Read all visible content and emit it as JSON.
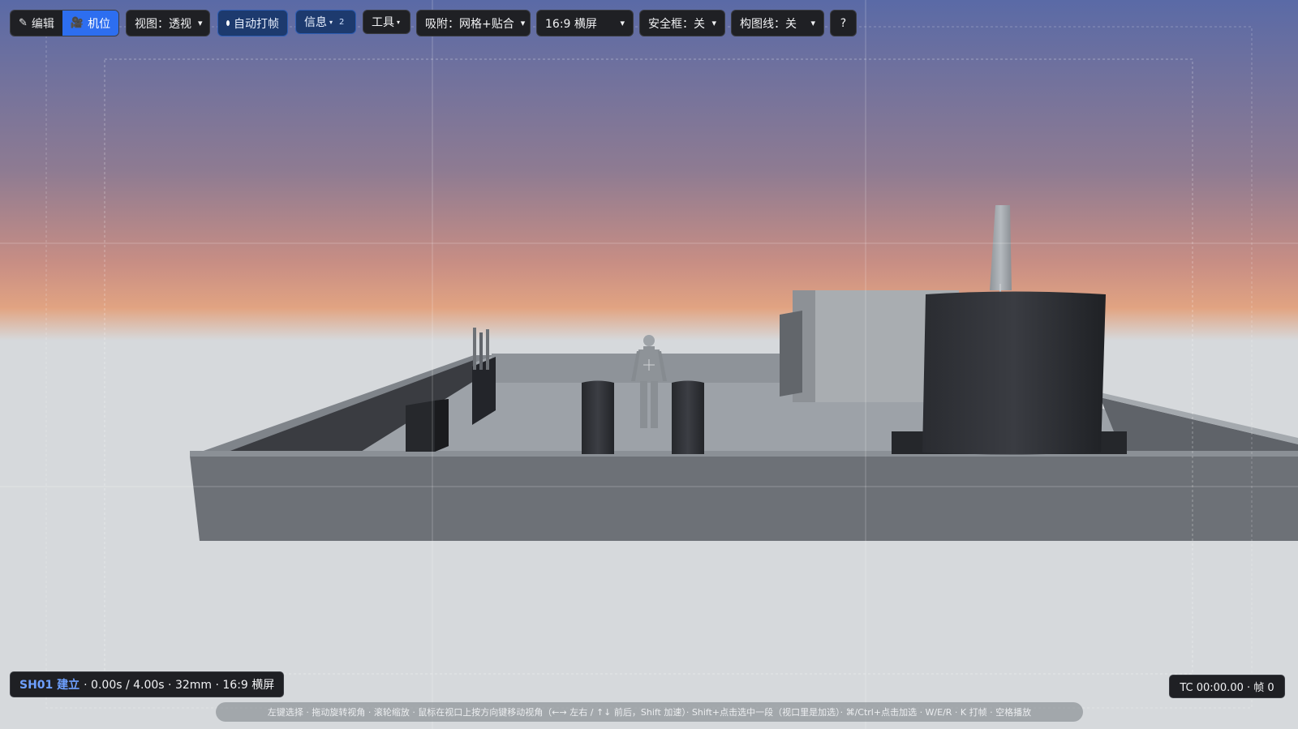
{
  "toolbar": {
    "edit_label": "编辑",
    "camera_label": "机位",
    "view_label": "视图：透视",
    "autokey_label": "自动打帧",
    "info_label": "信息",
    "info_count": "2",
    "tools_label": "工具",
    "snap_label": "吸附：网格+贴合",
    "aspect_label": "16:9 横屏",
    "safe_frame_label": "安全框：关",
    "composition_label": "构图线：关",
    "help_label": "?"
  },
  "shot": {
    "id": "SH01 建立",
    "details": "· 0.00s / 4.00s · 32mm · 16:9 横屏"
  },
  "timecode": "TC 00:00.00 · 帧 0",
  "help_text": "左键选择 · 拖动旋转视角 · 滚轮缩放 · 鼠标在视口上按方向键移动视角（←→ 左右 / ↑↓ 前后，Shift 加速）· Shift+点击选中一段（视口里是加选）· ⌘/Ctrl+点击加选 · W/E/R · K 打帧 · 空格播放",
  "colors": {
    "accent": "#2d6ef0",
    "toolbar_bg": "#1f2024",
    "sky_top": "#5a6aa6",
    "horizon": "#e2a482",
    "ground": "#d6d9dc"
  }
}
